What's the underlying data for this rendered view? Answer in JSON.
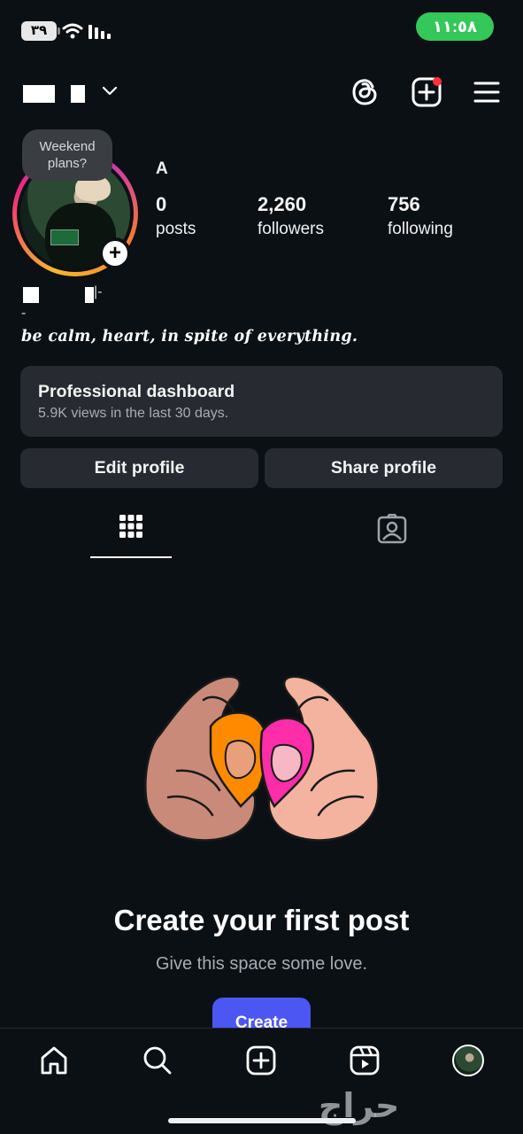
{
  "status_bar": {
    "battery": "٣٩",
    "time": "١١:٥٨"
  },
  "header": {
    "icons": [
      "chevron-down-icon",
      "threads-icon",
      "add-post-icon",
      "menu-icon"
    ]
  },
  "note": {
    "text": "Weekend plans?"
  },
  "profile": {
    "display_name": "A",
    "stats": [
      {
        "value": "0",
        "label": "posts"
      },
      {
        "value": "2,260",
        "label": "followers"
      },
      {
        "value": "756",
        "label": "following"
      }
    ],
    "bio_line1_suffix": "|-",
    "bio_line2": "-",
    "bio": "be calm, heart, in spite of everything."
  },
  "dashboard": {
    "title": "Professional dashboard",
    "subtitle": "5.9K views in the last 30 days."
  },
  "buttons": {
    "edit": "Edit profile",
    "share": "Share profile"
  },
  "tabs": [
    "grid-icon",
    "tagged-icon"
  ],
  "empty_state": {
    "title": "Create your first post",
    "subtitle": "Give this space some love.",
    "button": "Create"
  },
  "bottom_nav": [
    "home-icon",
    "search-icon",
    "create-icon",
    "reels-icon",
    "profile-avatar"
  ],
  "watermark": "حراج",
  "colors": {
    "background": "#0b1014",
    "card": "#272b31",
    "accent": "#4c56f2",
    "time_pill": "#34c759",
    "notification": "#ff3040"
  }
}
